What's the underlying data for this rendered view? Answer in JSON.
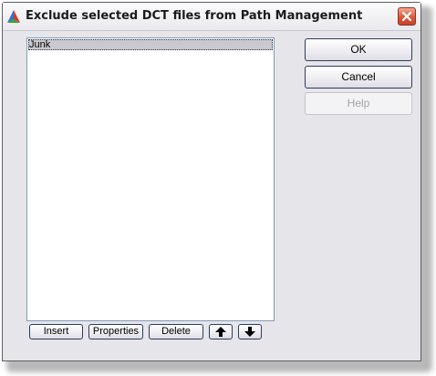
{
  "window": {
    "title": "Exclude selected DCT files from Path Management"
  },
  "list": {
    "items": [
      "Junk"
    ]
  },
  "buttons": {
    "ok": "OK",
    "cancel": "Cancel",
    "help": "Help",
    "insert": "Insert",
    "properties": "Properties",
    "delete": "Delete"
  },
  "icons": {
    "app": "autodesk-triangle-icon",
    "close": "close-icon",
    "move_up": "arrow-up-icon",
    "move_down": "arrow-down-icon"
  },
  "colors": {
    "close_button": "#d9573b",
    "dialog_bg": "#e6e5ea",
    "selection": "#c9c9d0"
  }
}
